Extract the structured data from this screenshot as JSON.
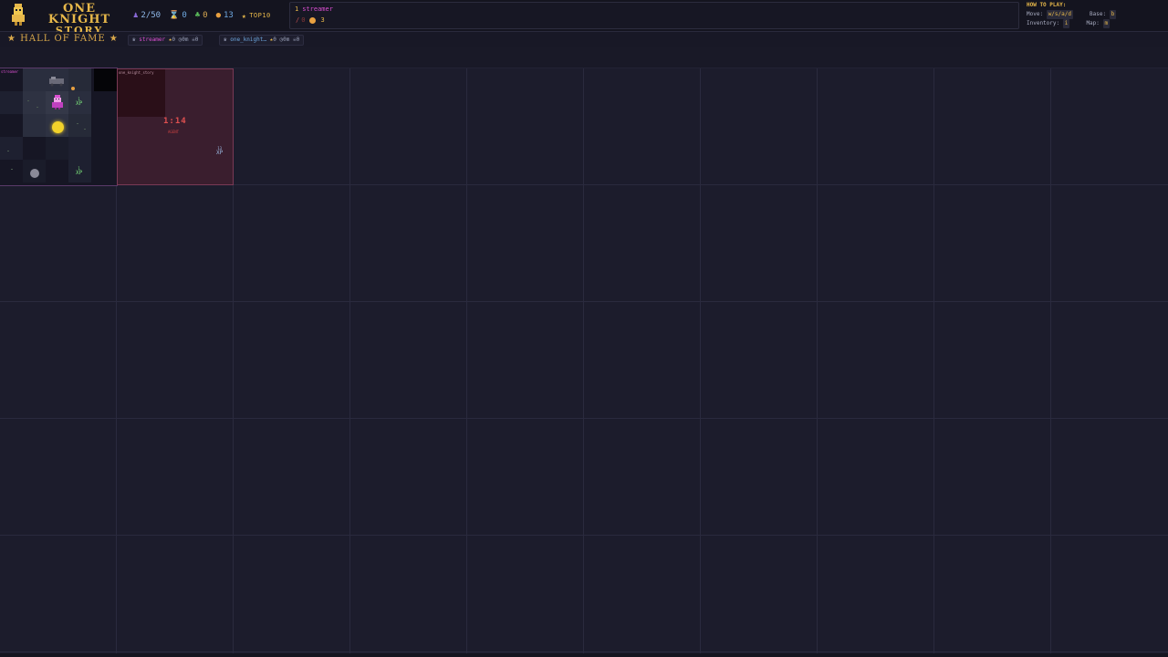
{
  "header": {
    "logo_line1": "ONE KNIGHT",
    "logo_line2": "STORY",
    "stats": {
      "players": "2/50",
      "time": "0",
      "herbs": "0",
      "coins": "13",
      "top_label": "TOP10"
    },
    "leader": {
      "rank": "1",
      "name": "streamer",
      "kills": "0",
      "coins": "3"
    },
    "howto": {
      "title": "HOW TO PLAY:",
      "move_label": "Move:",
      "move_keys": "w/s/a/d",
      "base_label": "Base:",
      "base_key": "b",
      "inventory_label": "Inventory:",
      "inventory_key": "i",
      "map_label": "Map:",
      "map_key": "m"
    }
  },
  "hall_of_fame": {
    "title": "★ HALL OF FAME ★",
    "entries": [
      {
        "name": "streamer",
        "stars": "0",
        "time": "0m",
        "deaths": "0"
      },
      {
        "name": "one_knight…",
        "stars": "0",
        "time": "0m",
        "deaths": "0"
      }
    ]
  },
  "rooms": [
    {
      "owner": "streamer",
      "xp_a": {
        "num": "1",
        "label": "XP"
      },
      "xp_b": {
        "num": "1",
        "label": "XP"
      }
    },
    {
      "owner": "one_knight_story",
      "timer": "1:14",
      "timer_sub": "AGENT",
      "xp": {
        "num": "13",
        "label": "XP"
      }
    }
  ],
  "colors": {
    "background": "#1c1c2c",
    "gold": "#e7b84a",
    "player_magenta": "#d94fd0",
    "player_blue": "#6ea8e0",
    "timer_red": "#e05050"
  }
}
